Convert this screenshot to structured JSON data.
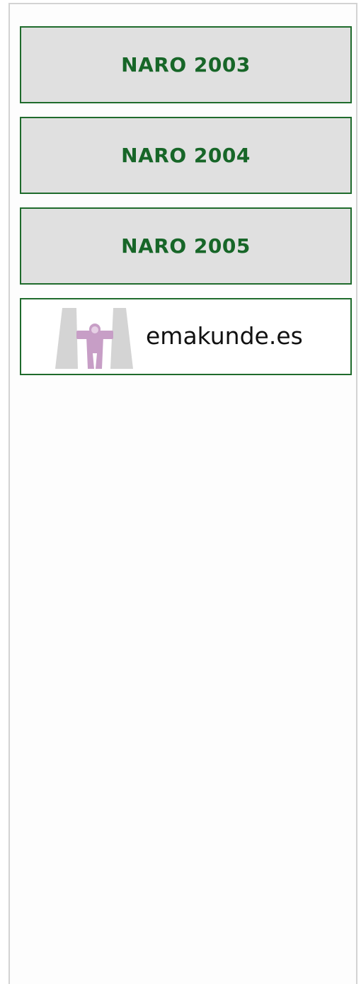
{
  "nav": {
    "items": [
      {
        "label": "NARO 2003"
      },
      {
        "label": "NARO 2004"
      },
      {
        "label": "NARO 2005"
      }
    ]
  },
  "emakunde_link": {
    "label": "emakunde.es",
    "icon": "emakunde-logo-icon"
  },
  "colors": {
    "button_border": "#1f6b2c",
    "button_text": "#176628",
    "button_bg": "#e0e0e0",
    "logo_gray": "#d4d4d4",
    "logo_figure": "#c79ec6"
  }
}
